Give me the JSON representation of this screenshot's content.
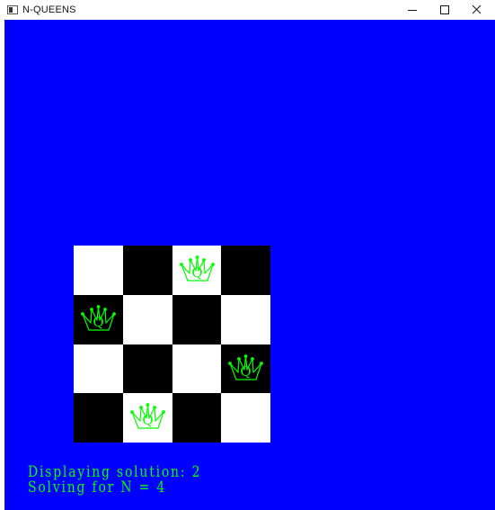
{
  "window": {
    "title": "N-QUEENS",
    "buttons": {
      "minimize": "minimize-icon",
      "maximize": "maximize-icon",
      "close": "close-icon"
    }
  },
  "colors": {
    "background": "#0000ff",
    "light_square": "#ffffff",
    "dark_square": "#000000",
    "queen": "#00ff00",
    "text": "#00ff00"
  },
  "board": {
    "n": 4,
    "queen_label": "Q",
    "queens": [
      {
        "row": 0,
        "col": 2
      },
      {
        "row": 1,
        "col": 0
      },
      {
        "row": 2,
        "col": 3
      },
      {
        "row": 3,
        "col": 1
      }
    ]
  },
  "status": {
    "line1": "Displaying solution: 2",
    "line2": "Solving for N = 4"
  }
}
